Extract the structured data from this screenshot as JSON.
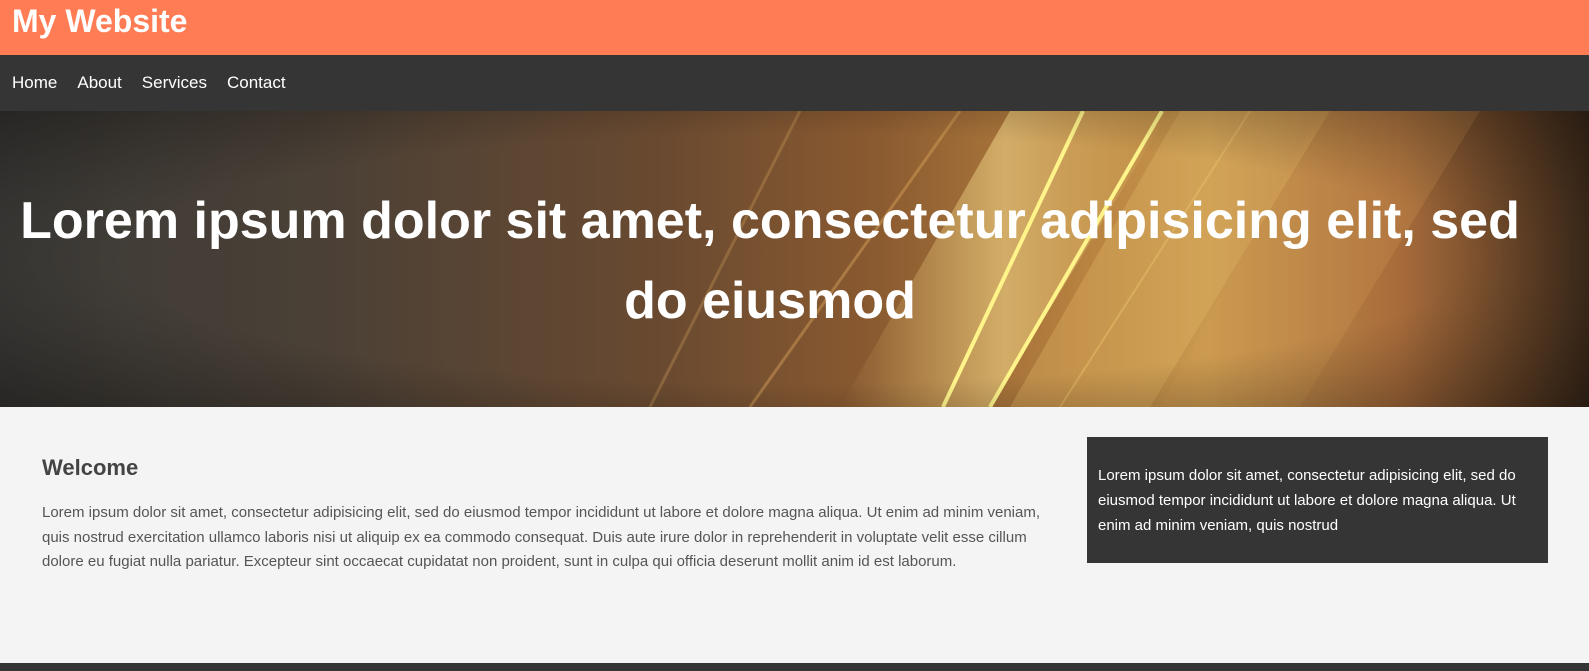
{
  "header": {
    "title": "My Website"
  },
  "nav": {
    "items": [
      "Home",
      "About",
      "Services",
      "Contact"
    ]
  },
  "hero": {
    "heading": "Lorem ipsum dolor sit amet, consectetur adipisicing elit, sed do eiusmod"
  },
  "main": {
    "heading": "Welcome",
    "body": "Lorem ipsum dolor sit amet, consectetur adipisicing elit, sed do eiusmod tempor incididunt ut labore et dolore magna aliqua. Ut enim ad minim veniam, quis nostrud exercitation ullamco laboris nisi ut aliquip ex ea commodo consequat. Duis aute irure dolor in reprehenderit in voluptate velit esse cillum dolore eu fugiat nulla pariatur. Excepteur sint occaecat cupidatat non proident, sunt in culpa qui officia deserunt mollit anim id est laborum."
  },
  "aside": {
    "text": "Lorem ipsum dolor sit amet, consectetur adipisicing elit, sed do eiusmod tempor incididunt ut labore et dolore magna aliqua. Ut enim ad minim veniam, quis nostrud"
  },
  "colors": {
    "header_bg": "#ff7c55",
    "nav_bg": "#353535",
    "page_bg": "#f4f4f4",
    "aside_bg": "#353535"
  }
}
